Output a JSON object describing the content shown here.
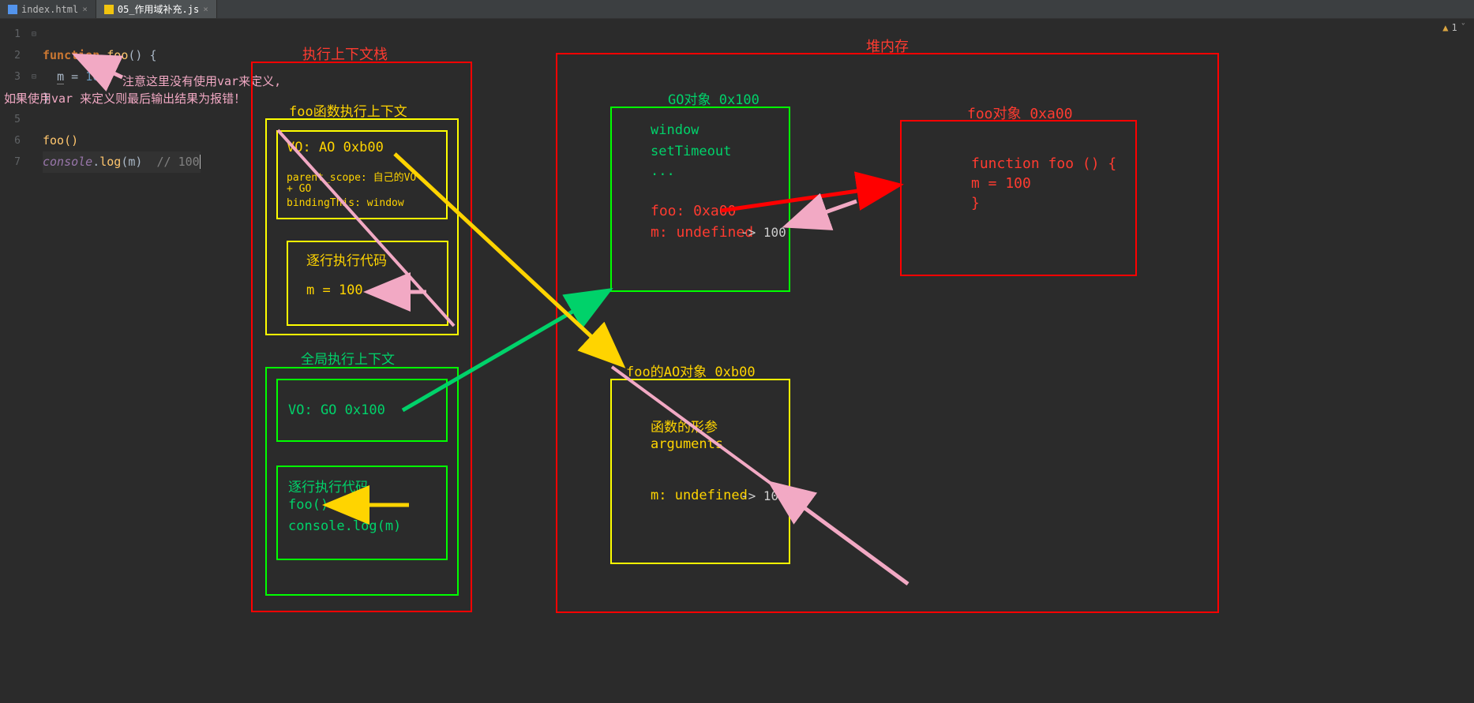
{
  "tabs": [
    {
      "label": "index.html",
      "active": false
    },
    {
      "label": "05_作用域补充.js",
      "active": true
    }
  ],
  "warning_count": "1",
  "gutter": [
    "1",
    "2",
    "3",
    "4",
    "5",
    "6",
    "7"
  ],
  "code": {
    "l1_kw_function": "function",
    "l1_fn": "foo",
    "l1_rest": "() {",
    "l2_var": "m",
    "l2_eq": " = ",
    "l2_num": "100",
    "l3": "}",
    "l5_call": "foo()",
    "l6_obj": "console",
    "l6_dot": ".",
    "l6_fn": "log",
    "l6_arg_open": "(",
    "l6_arg": "m",
    "l6_arg_close": ")",
    "l6_comment": "// 100"
  },
  "annotations": {
    "note_no_var_line1": "注意这里没有使用var来定义,",
    "note_no_var_line2": "如果使用var 来定义则最后输出结果为报错！"
  },
  "stack": {
    "title": "执行上下文栈",
    "foo_ctx": {
      "title": "foo函数执行上下文",
      "vo_header": "VO: AO 0xb00",
      "vo_body_l1": "parent_scope: 自己的VO",
      "vo_body_l2": "+ GO",
      "vo_body_l3": "bindingThis: window",
      "exec_title": "逐行执行代码",
      "exec_l1": "m = 100"
    },
    "global_ctx": {
      "title": "全局执行上下文",
      "vo_header": "VO: GO 0x100",
      "exec_title": "逐行执行代码",
      "exec_l1": "foo()",
      "exec_l2": "console.log(m)"
    }
  },
  "heap": {
    "title": "堆内存",
    "go": {
      "title": "GO对象 0x100",
      "l1": "window",
      "l2": "setTimeout",
      "l3": "...",
      "l4": "foo: 0xa00",
      "l5": "m: undefined",
      "l5_extra": "-> 100"
    },
    "ao": {
      "title": "foo的AO对象 0xb00",
      "l1": "函数的形参",
      "l2": "arguments",
      "l3": "m: undefined",
      "l3_extra": "-> 100"
    },
    "foo_obj": {
      "title": "foo对象 0xa00",
      "l1": "function foo () {",
      "l2": "  m = 100",
      "l3": "}"
    }
  }
}
